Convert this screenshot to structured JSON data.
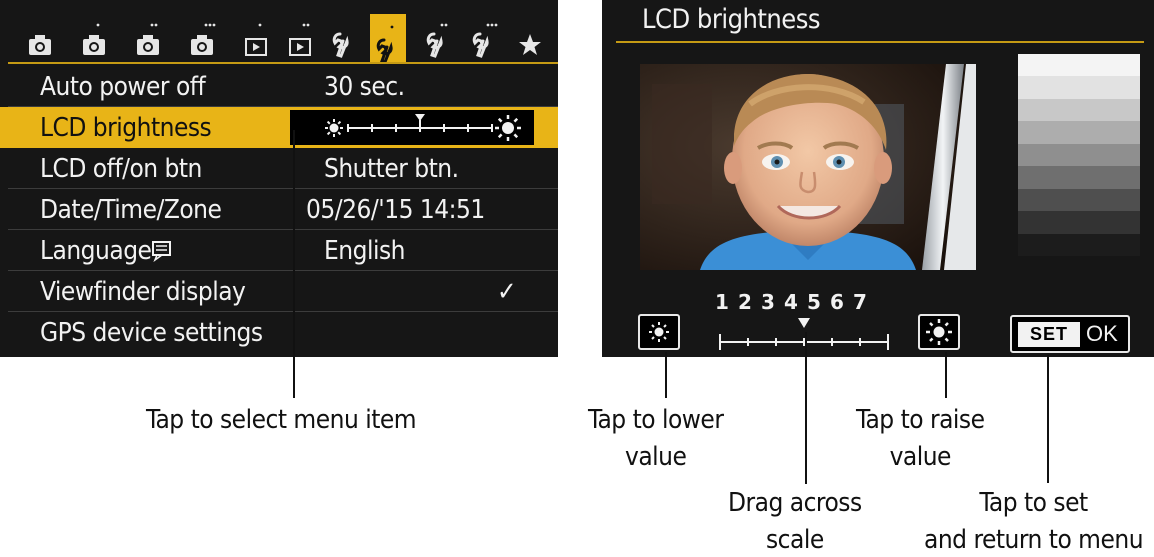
{
  "menu_screen": {
    "tabs": [
      {
        "icon": "camera-icon"
      },
      {
        "icon": "camera-icon"
      },
      {
        "icon": "camera-icon"
      },
      {
        "icon": "camera-icon"
      },
      {
        "icon": "playback-icon"
      },
      {
        "icon": "playback-icon"
      },
      {
        "icon": "wrench-icon"
      },
      {
        "icon": "wrench-icon",
        "active": true
      },
      {
        "icon": "wrench-icon"
      },
      {
        "icon": "wrench-icon"
      },
      {
        "icon": "star-icon"
      }
    ],
    "items": [
      {
        "label": "Auto power off",
        "value": "30 sec."
      },
      {
        "label": "LCD brightness",
        "value": "",
        "brightness_level": 4,
        "brightness_max": 7
      },
      {
        "label": "LCD off/on btn",
        "value": "Shutter btn."
      },
      {
        "label": "Date/Time/Zone",
        "value": "05/26/'15 14:51"
      },
      {
        "label": "Language",
        "value": "English"
      },
      {
        "label": "Viewfinder display",
        "value": "✓"
      },
      {
        "label": "GPS device settings",
        "value": ""
      }
    ]
  },
  "lcd_screen": {
    "title": "LCD brightness",
    "scale_numbers": [
      "1",
      "2",
      "3",
      "4",
      "5",
      "6",
      "7"
    ],
    "current_level": 4,
    "set_label": "SET",
    "ok_label": "OK",
    "grayscale": [
      "#f4f4f4",
      "#e2e2e2",
      "#c8c8c8",
      "#adadad",
      "#8f8f8f",
      "#6f6f6f",
      "#4f4f4f",
      "#333333",
      "#1c1c1c"
    ]
  },
  "callouts": {
    "select_menu": "Tap to select menu item",
    "lower_value": [
      "Tap to lower",
      "value"
    ],
    "drag_scale": [
      "Drag across",
      "scale"
    ],
    "raise_value": [
      "Tap to raise",
      "value"
    ],
    "set_return": [
      "Tap to set",
      "and return to menu"
    ]
  },
  "colors": {
    "accent": "#e8b417",
    "screen_bg": "#161616",
    "text": "#f2f2f2"
  }
}
